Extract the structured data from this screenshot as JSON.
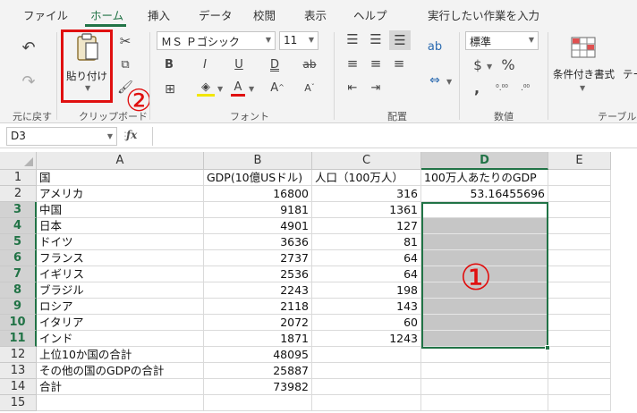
{
  "tabs": [
    "ファイル",
    "ホーム",
    "挿入",
    "データ",
    "校閲",
    "表示",
    "ヘルプ",
    "実行したい作業を入力"
  ],
  "active_tab": "ホーム",
  "ribbon": {
    "undo_label": "元に戻す",
    "clipboard_label": "クリップボード",
    "paste_label": "貼り付け",
    "font_group_label": "フォント",
    "font_name": "ＭＳ Ｐゴシック",
    "font_size": "11",
    "bold": "B",
    "italic": "I",
    "underline": "U",
    "double_underline": "D",
    "strike": "ab",
    "grow_font": "A",
    "shrink_font": "A",
    "alignment_label": "配置",
    "number_label": "数値",
    "number_format": "標準",
    "currency": "$",
    "percent": "%",
    "comma": ",",
    "table_label": "テーブル",
    "conditional_format": "条件付き書式",
    "table_format_partial": "テー"
  },
  "annotations": {
    "step_one": "①",
    "step_two": "②"
  },
  "formula_bar": {
    "name_box": "D3",
    "fx": "fx",
    "formula": ""
  },
  "columns": [
    "A",
    "B",
    "C",
    "D",
    "E"
  ],
  "rows": [
    {
      "n": "1",
      "a": "国",
      "b": "GDP(10億USドル)",
      "c": "人口（100万人）",
      "d": "100万人あたりのGDP"
    },
    {
      "n": "2",
      "a": "アメリカ",
      "b": "16800",
      "c": "316",
      "d": "53.16455696"
    },
    {
      "n": "3",
      "a": "中国",
      "b": "9181",
      "c": "1361",
      "d": ""
    },
    {
      "n": "4",
      "a": "日本",
      "b": "4901",
      "c": "127",
      "d": ""
    },
    {
      "n": "5",
      "a": "ドイツ",
      "b": "3636",
      "c": "81",
      "d": ""
    },
    {
      "n": "6",
      "a": "フランス",
      "b": "2737",
      "c": "64",
      "d": ""
    },
    {
      "n": "7",
      "a": "イギリス",
      "b": "2536",
      "c": "64",
      "d": ""
    },
    {
      "n": "8",
      "a": "ブラジル",
      "b": "2243",
      "c": "198",
      "d": ""
    },
    {
      "n": "9",
      "a": "ロシア",
      "b": "2118",
      "c": "143",
      "d": ""
    },
    {
      "n": "10",
      "a": "イタリア",
      "b": "2072",
      "c": "60",
      "d": ""
    },
    {
      "n": "11",
      "a": "インド",
      "b": "1871",
      "c": "1243",
      "d": ""
    },
    {
      "n": "12",
      "a": "上位10か国の合計",
      "b": "48095",
      "c": "",
      "d": ""
    },
    {
      "n": "13",
      "a": "その他の国のGDPの合計",
      "b": "25887",
      "c": "",
      "d": ""
    },
    {
      "n": "14",
      "a": "合計",
      "b": "73982",
      "c": "",
      "d": ""
    },
    {
      "n": "15",
      "a": "",
      "b": "",
      "c": "",
      "d": ""
    }
  ]
}
